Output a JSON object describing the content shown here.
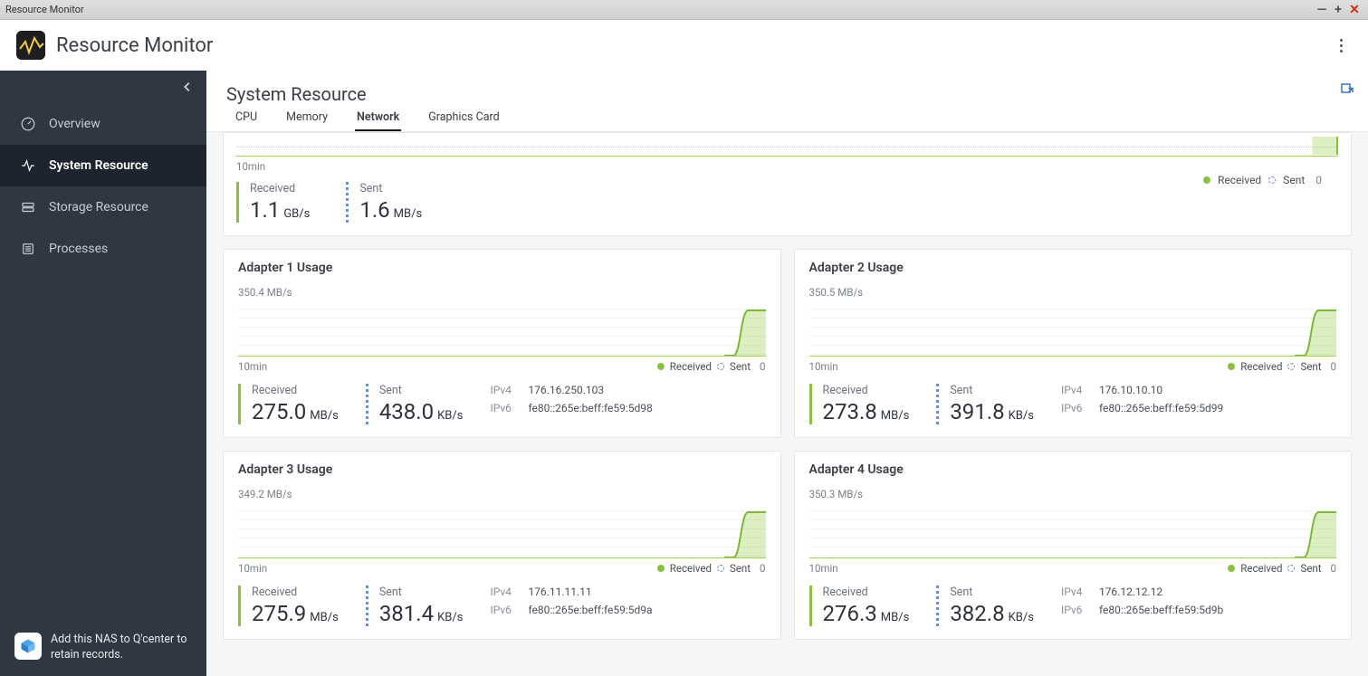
{
  "window": {
    "title": "Resource Monitor"
  },
  "app": {
    "title": "Resource Monitor"
  },
  "sidebar": {
    "items": [
      {
        "label": "Overview"
      },
      {
        "label": "System Resource"
      },
      {
        "label": "Storage Resource"
      },
      {
        "label": "Processes"
      }
    ],
    "footer": "Add this NAS to Q'center to retain records."
  },
  "page": {
    "title": "System Resource",
    "tabs": [
      {
        "label": "CPU"
      },
      {
        "label": "Memory"
      },
      {
        "label": "Network"
      },
      {
        "label": "Graphics Card"
      }
    ]
  },
  "legend": {
    "received": "Received",
    "sent": "Sent",
    "zero": "0",
    "time": "10min"
  },
  "overall": {
    "received_label": "Received",
    "received_val": "1.1",
    "received_unit": "GB/s",
    "sent_label": "Sent",
    "sent_val": "1.6",
    "sent_unit": "MB/s"
  },
  "adapters": [
    {
      "title": "Adapter 1 Usage",
      "max": "350.4 MB/s",
      "time": "10min",
      "rx_label": "Received",
      "rx_val": "275.0",
      "rx_unit": "MB/s",
      "tx_label": "Sent",
      "tx_val": "438.0",
      "tx_unit": "KB/s",
      "ipv4_lab": "IPv4",
      "ipv4": "176.16.250.103",
      "ipv6_lab": "IPv6",
      "ipv6": "fe80::265e:beff:fe59:5d98"
    },
    {
      "title": "Adapter 2 Usage",
      "max": "350.5 MB/s",
      "time": "10min",
      "rx_label": "Received",
      "rx_val": "273.8",
      "rx_unit": "MB/s",
      "tx_label": "Sent",
      "tx_val": "391.8",
      "tx_unit": "KB/s",
      "ipv4_lab": "IPv4",
      "ipv4": "176.10.10.10",
      "ipv6_lab": "IPv6",
      "ipv6": "fe80::265e:beff:fe59:5d99"
    },
    {
      "title": "Adapter 3 Usage",
      "max": "349.2 MB/s",
      "time": "10min",
      "rx_label": "Received",
      "rx_val": "275.9",
      "rx_unit": "MB/s",
      "tx_label": "Sent",
      "tx_val": "381.4",
      "tx_unit": "KB/s",
      "ipv4_lab": "IPv4",
      "ipv4": "176.11.11.11",
      "ipv6_lab": "IPv6",
      "ipv6": "fe80::265e:beff:fe59:5d9a"
    },
    {
      "title": "Adapter 4 Usage",
      "max": "350.3 MB/s",
      "time": "10min",
      "rx_label": "Received",
      "rx_val": "276.3",
      "rx_unit": "MB/s",
      "tx_label": "Sent",
      "tx_val": "382.8",
      "tx_unit": "KB/s",
      "ipv4_lab": "IPv4",
      "ipv4": "176.12.12.12",
      "ipv6_lab": "IPv6",
      "ipv6": "fe80::265e:beff:fe59:5d9b"
    }
  ],
  "chart_data": [
    {
      "type": "line",
      "title": "Overall network usage",
      "x_range_label": "10min",
      "series": [
        {
          "name": "Received",
          "unit": "GB/s",
          "current": 1.1
        },
        {
          "name": "Sent",
          "unit": "MB/s",
          "current": 1.6
        }
      ],
      "note": "Flat near zero until a sharp rise at the rightmost edge."
    },
    {
      "type": "line",
      "title": "Adapter 1 Usage",
      "x_range_label": "10min",
      "ylim": [
        0,
        350.4
      ],
      "y_unit": "MB/s",
      "series": [
        {
          "name": "Received",
          "current": 275.0,
          "unit": "MB/s"
        },
        {
          "name": "Sent",
          "current": 438.0,
          "unit": "KB/s"
        }
      ]
    },
    {
      "type": "line",
      "title": "Adapter 2 Usage",
      "x_range_label": "10min",
      "ylim": [
        0,
        350.5
      ],
      "y_unit": "MB/s",
      "series": [
        {
          "name": "Received",
          "current": 273.8,
          "unit": "MB/s"
        },
        {
          "name": "Sent",
          "current": 391.8,
          "unit": "KB/s"
        }
      ]
    },
    {
      "type": "line",
      "title": "Adapter 3 Usage",
      "x_range_label": "10min",
      "ylim": [
        0,
        349.2
      ],
      "y_unit": "MB/s",
      "series": [
        {
          "name": "Received",
          "current": 275.9,
          "unit": "MB/s"
        },
        {
          "name": "Sent",
          "current": 381.4,
          "unit": "KB/s"
        }
      ]
    },
    {
      "type": "line",
      "title": "Adapter 4 Usage",
      "x_range_label": "10min",
      "ylim": [
        0,
        350.3
      ],
      "y_unit": "MB/s",
      "series": [
        {
          "name": "Received",
          "current": 276.3,
          "unit": "MB/s"
        },
        {
          "name": "Sent",
          "current": 382.8,
          "unit": "KB/s"
        }
      ]
    }
  ]
}
